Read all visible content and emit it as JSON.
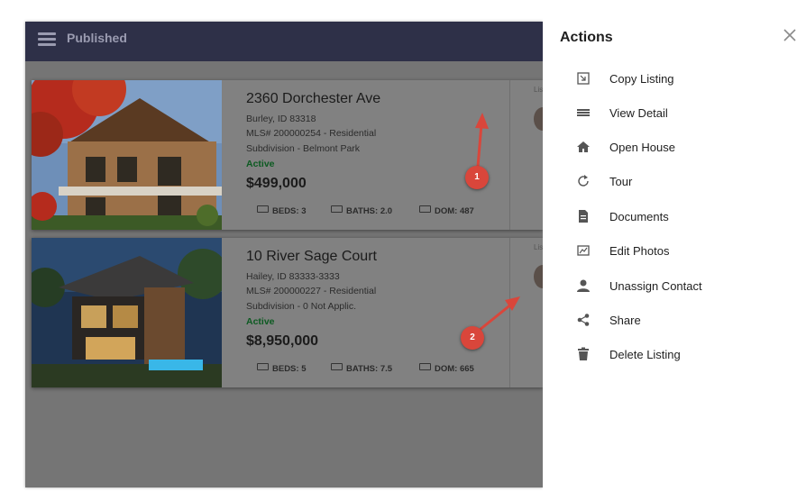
{
  "topbar": {
    "title": "Published"
  },
  "listings": [
    {
      "address": "2360 Dorchester Ave",
      "city_line": "Burley, ID 83318",
      "mls_line": "MLS# 200000254 - Residential",
      "subdivision_line": "Subdivision - Belmont Park",
      "status": "Active",
      "price": "$499,000",
      "beds": "BEDS: 3",
      "baths": "BATHS: 2.0",
      "dom": "DOM: 487",
      "side_label": "Lis"
    },
    {
      "address": "10 River Sage Court",
      "city_line": "Hailey, ID 83333-3333",
      "mls_line": "MLS# 200000227 - Residential",
      "subdivision_line": "Subdivision - 0 Not Applic.",
      "status": "Active",
      "price": "$8,950,000",
      "beds": "BEDS: 5",
      "baths": "BATHS: 7.5",
      "dom": "DOM: 665",
      "side_label": "Lis"
    }
  ],
  "callouts": [
    "1",
    "2"
  ],
  "drawer": {
    "title": "Actions",
    "actions": [
      {
        "label": "Copy Listing",
        "icon": "copy-listing-icon"
      },
      {
        "label": "View Detail",
        "icon": "view-detail-icon"
      },
      {
        "label": "Open House",
        "icon": "home-icon"
      },
      {
        "label": "Tour",
        "icon": "tour-icon"
      },
      {
        "label": "Documents",
        "icon": "document-icon"
      },
      {
        "label": "Edit Photos",
        "icon": "edit-photos-icon"
      },
      {
        "label": "Unassign Contact",
        "icon": "person-icon"
      },
      {
        "label": "Share",
        "icon": "share-icon"
      },
      {
        "label": "Delete Listing",
        "icon": "trash-icon"
      }
    ]
  },
  "colors": {
    "topbar": "#2e3048",
    "overlay": "#757575",
    "status_active": "#0c5a21",
    "callout": "#d9463b"
  }
}
